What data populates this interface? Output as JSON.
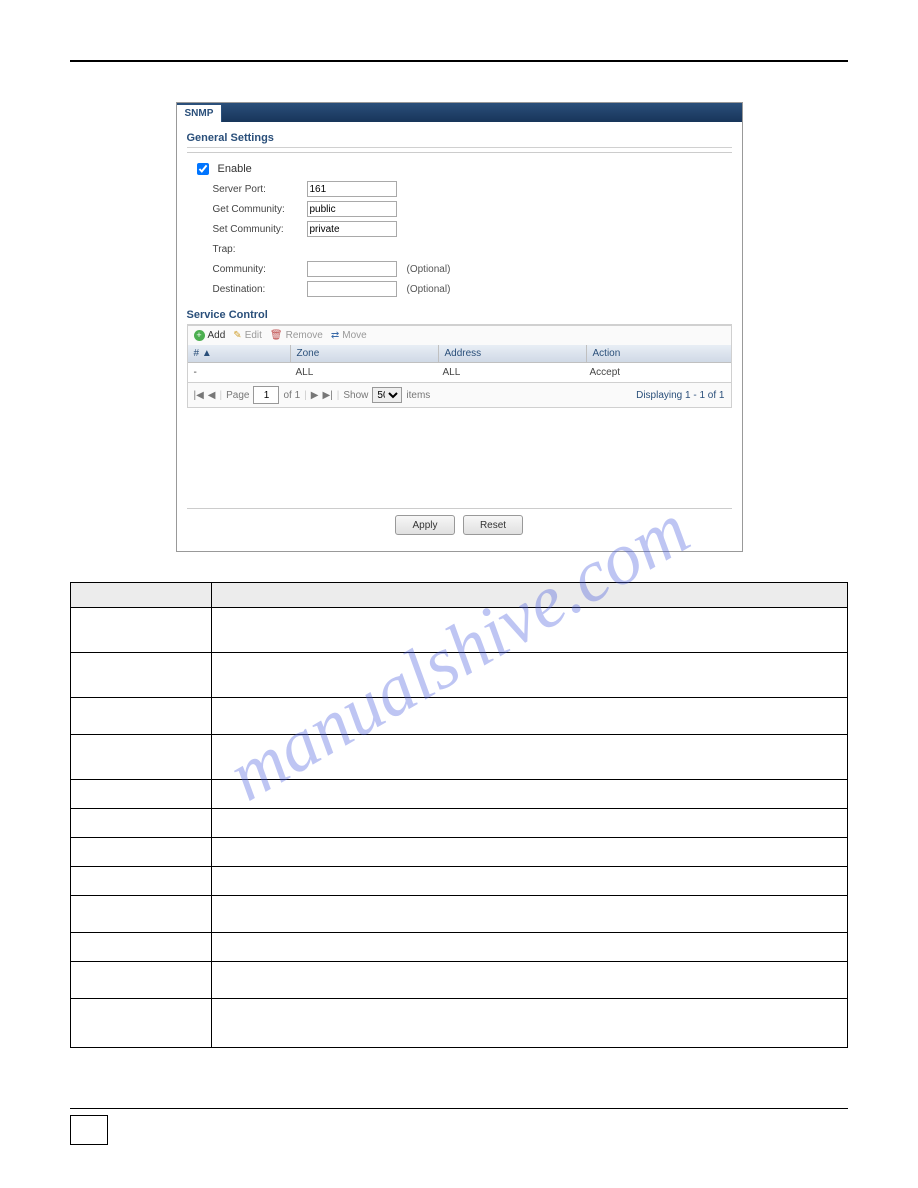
{
  "tab": {
    "label": "SNMP"
  },
  "sections": {
    "general": "General Settings",
    "service": "Service Control"
  },
  "form": {
    "enable_label": "Enable",
    "server_port_label": "Server Port:",
    "server_port_value": "161",
    "get_community_label": "Get Community:",
    "get_community_value": "public",
    "set_community_label": "Set Community:",
    "set_community_value": "private",
    "trap_label": "Trap:",
    "community_label": "Community:",
    "community_value": "",
    "community_opt": "(Optional)",
    "destination_label": "Destination:",
    "destination_value": "",
    "destination_opt": "(Optional)"
  },
  "toolbar": {
    "add": "Add",
    "edit": "Edit",
    "remove": "Remove",
    "move": "Move"
  },
  "grid": {
    "headers": {
      "num": "# ▲",
      "zone": "Zone",
      "address": "Address",
      "action": "Action"
    },
    "row": {
      "num": "-",
      "zone": "ALL",
      "address": "ALL",
      "action": "Accept"
    }
  },
  "pager": {
    "page_label": "Page",
    "page_value": "1",
    "of_label": "of 1",
    "show_label": "Show",
    "show_value": "50",
    "items_label": "items",
    "displaying": "Displaying 1 - 1 of 1"
  },
  "buttons": {
    "apply": "Apply",
    "reset": "Reset"
  },
  "table_rows": [
    "",
    "",
    "",
    "",
    "",
    "",
    "",
    "",
    "",
    "",
    "",
    ""
  ],
  "desc_row_heights": [
    24,
    44,
    44,
    36,
    44,
    28,
    28,
    28,
    28,
    36,
    28,
    36,
    48
  ],
  "watermark": "manualshive.com"
}
